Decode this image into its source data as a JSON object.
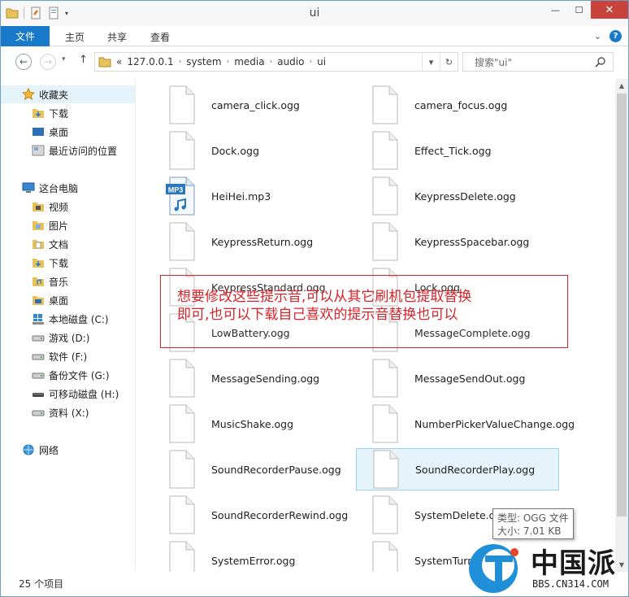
{
  "window": {
    "title": "ui",
    "controls": {
      "minimize": "—",
      "maximize": "☐",
      "close": "✕"
    }
  },
  "ribbon": {
    "file_tab": "文件",
    "tabs": [
      "主页",
      "共享",
      "查看"
    ]
  },
  "address": {
    "overflow": "«",
    "breadcrumbs": [
      "127.0.0.1",
      "system",
      "media",
      "audio",
      "ui"
    ]
  },
  "search": {
    "placeholder": "搜索\"ui\""
  },
  "sidebar": {
    "favorites": {
      "label": "收藏夹",
      "items": [
        "下载",
        "桌面",
        "最近访问的位置"
      ]
    },
    "this_pc": {
      "label": "这台电脑",
      "items": [
        "视频",
        "图片",
        "文档",
        "下载",
        "音乐",
        "桌面",
        "本地磁盘 (C:)",
        "游戏 (D:)",
        "软件 (F:)",
        "备份文件 (G:)",
        "可移动磁盘 (H:)",
        "资料 (X:)"
      ]
    },
    "network": {
      "label": "网络"
    }
  },
  "files": [
    "camera_click.ogg",
    "camera_focus.ogg",
    "Dock.ogg",
    "Effect_Tick.ogg",
    "HeiHei.mp3",
    "KeypressDelete.ogg",
    "KeypressReturn.ogg",
    "KeypressSpacebar.ogg",
    "KeypressStandard.ogg",
    "Lock.ogg",
    "LowBattery.ogg",
    "MessageComplete.ogg",
    "MessageSending.ogg",
    "MessageSendOut.ogg",
    "MusicShake.ogg",
    "NumberPickerValueChange.ogg",
    "SoundRecorderPause.ogg",
    "SoundRecorderPlay.ogg",
    "SoundRecorderRewind.ogg",
    "SystemDelete.ogg",
    "SystemError.ogg",
    "SystemTurnOff.ogg"
  ],
  "selected_file": "SoundRecorderPlay.ogg",
  "mp3_badge": "MP3",
  "tooltip": {
    "type": "类型: OGG 文件",
    "size": "大小: 7.01 KB"
  },
  "status": {
    "item_count": "25 个项目"
  },
  "annotation": {
    "line1": "想要修改这些提示音,可以从其它刷机包提取替换",
    "line2": "即可,也可以下载自己喜欢的提示音替换也可以"
  },
  "watermark": {
    "brand": "中国派",
    "url": "BBS.CN314.COM"
  },
  "colors": {
    "accent": "#1979ca",
    "annotation": "#d8232a",
    "selection": "#e5f3fb"
  }
}
